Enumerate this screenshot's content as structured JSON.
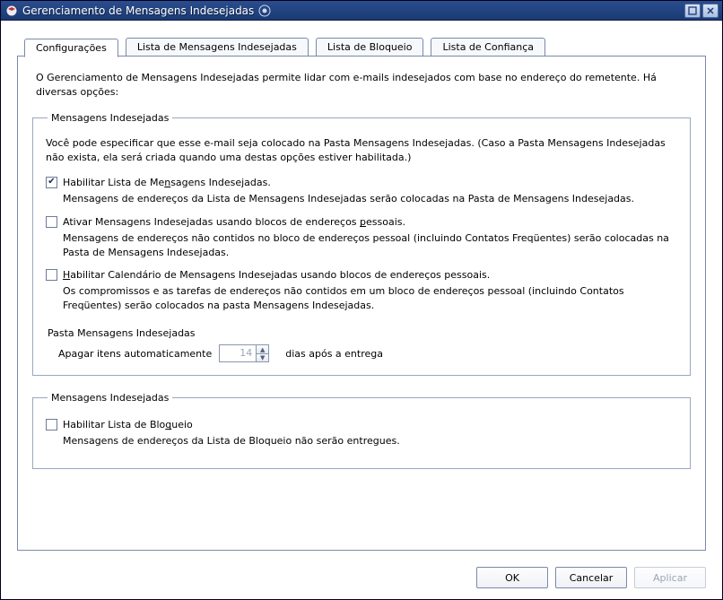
{
  "window": {
    "title": "Gerenciamento de Mensagens Indesejadas"
  },
  "tabs": [
    {
      "label": "Configurações",
      "active": true
    },
    {
      "label": "Lista de Mensagens Indesejadas",
      "active": false
    },
    {
      "label": "Lista de Bloqueio",
      "active": false
    },
    {
      "label": "Lista de Confiança",
      "active": false
    }
  ],
  "intro": "O Gerenciamento de Mensagens Indesejadas permite lidar com e-mails indesejados com base no endereço do remetente. Há diversas opções:",
  "group1": {
    "legend": "Mensagens Indesejadas",
    "lead": "Você pode especificar que esse e-mail seja colocado na Pasta Mensagens Indesejadas. (Caso a Pasta Mensagens Indesejadas não exista, ela será criada quando uma destas opções estiver habilitada.)",
    "opt1": {
      "checked": true,
      "pre": "Habilitar Lista de Me",
      "ul": "n",
      "post": "sagens Indesejadas.",
      "desc": "Mensagens de endereços da Lista de Mensagens Indesejadas serão colocadas na Pasta de Mensagens Indesejadas."
    },
    "opt2": {
      "checked": false,
      "pre": "Ativar Mensagens Indesejadas usando blocos de endereços ",
      "ul": "p",
      "post": "essoais.",
      "desc": "Mensagens de endereços não contidos no bloco de endereços pessoal (incluindo Contatos Freqüentes) serão colocadas na Pasta de Mensagens Indesejadas."
    },
    "opt3": {
      "checked": false,
      "ul": "H",
      "post": "abilitar Calendário de Mensagens Indesejadas usando blocos de endereços pessoais.",
      "desc": "Os compromissos e as tarefas de endereços não contidos em um bloco de endereços pessoal (incluindo Contatos Freqüentes) serão colocados na pasta Mensagens Indesejadas."
    },
    "folder_label": "Pasta Mensagens Indesejadas",
    "auto_delete": {
      "checked": false,
      "label": "Apagar itens automaticamente",
      "days_value": "14",
      "days_suffix": "dias após a entrega"
    }
  },
  "group2": {
    "legend": "Mensagens Indesejadas",
    "opt": {
      "checked": false,
      "pre": "Habilitar Lista de Blo",
      "ul": "q",
      "post": "ueio",
      "desc": "Mensagens de endereços da Lista de Bloqueio não serão entregues."
    }
  },
  "buttons": {
    "ok": "OK",
    "cancel": "Cancelar",
    "apply": "Aplicar"
  }
}
